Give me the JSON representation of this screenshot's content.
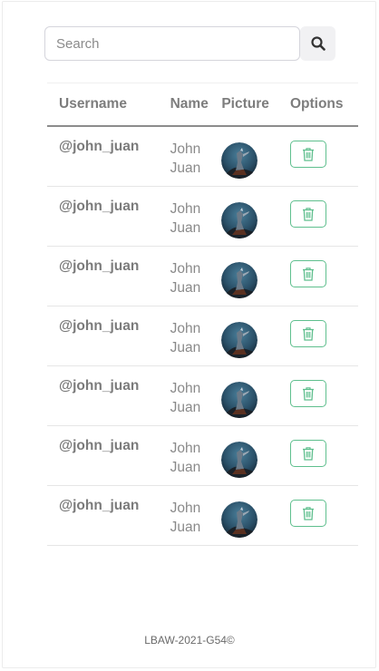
{
  "search": {
    "placeholder": "Search",
    "value": "",
    "button_icon": "search-icon"
  },
  "table": {
    "headers": {
      "username": "Username",
      "name": "Name",
      "picture": "Picture",
      "options": "Options"
    },
    "rows": [
      {
        "username": "@john_juan",
        "first": "John",
        "last": "Juan",
        "avatar_icon": "avatar-image",
        "action_icon": "trash-icon"
      },
      {
        "username": "@john_juan",
        "first": "John",
        "last": "Juan",
        "avatar_icon": "avatar-image",
        "action_icon": "trash-icon"
      },
      {
        "username": "@john_juan",
        "first": "John",
        "last": "Juan",
        "avatar_icon": "avatar-image",
        "action_icon": "trash-icon"
      },
      {
        "username": "@john_juan",
        "first": "John",
        "last": "Juan",
        "avatar_icon": "avatar-image",
        "action_icon": "trash-icon"
      },
      {
        "username": "@john_juan",
        "first": "John",
        "last": "Juan",
        "avatar_icon": "avatar-image",
        "action_icon": "trash-icon"
      },
      {
        "username": "@john_juan",
        "first": "John",
        "last": "Juan",
        "avatar_icon": "avatar-image",
        "action_icon": "trash-icon"
      },
      {
        "username": "@john_juan",
        "first": "John",
        "last": "Juan",
        "avatar_icon": "avatar-image",
        "action_icon": "trash-icon"
      }
    ]
  },
  "footer": {
    "text": "LBAW-2021-G54©"
  },
  "colors": {
    "accent_green": "#5fbf8e",
    "header_rule": "#8c8c8c",
    "text_gray": "#7b7b7b"
  }
}
